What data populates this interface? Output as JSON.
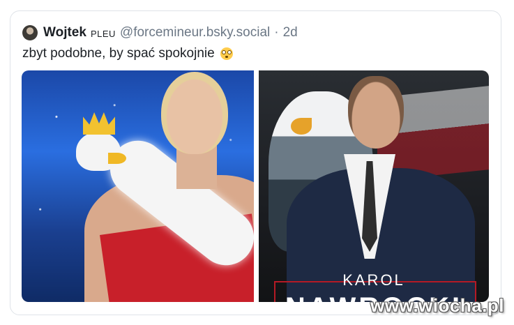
{
  "post": {
    "author_name": "Wojtek",
    "author_tag": "PLEU",
    "handle": "@forcemineur.bsky.social",
    "separator": "·",
    "time": "2d",
    "text": "zbyt podobne, by spać spokojnie",
    "emoji_icon": "flushed-face-icon"
  },
  "media": {
    "right_image": {
      "first_name": "KAROL",
      "surname": "NAWROCKI"
    }
  },
  "watermark": {
    "text": "www.wiocha.pl"
  },
  "colors": {
    "handle_gray": "#6b7785",
    "border": "#dfe3e8",
    "red_frame": "#b51a25"
  }
}
